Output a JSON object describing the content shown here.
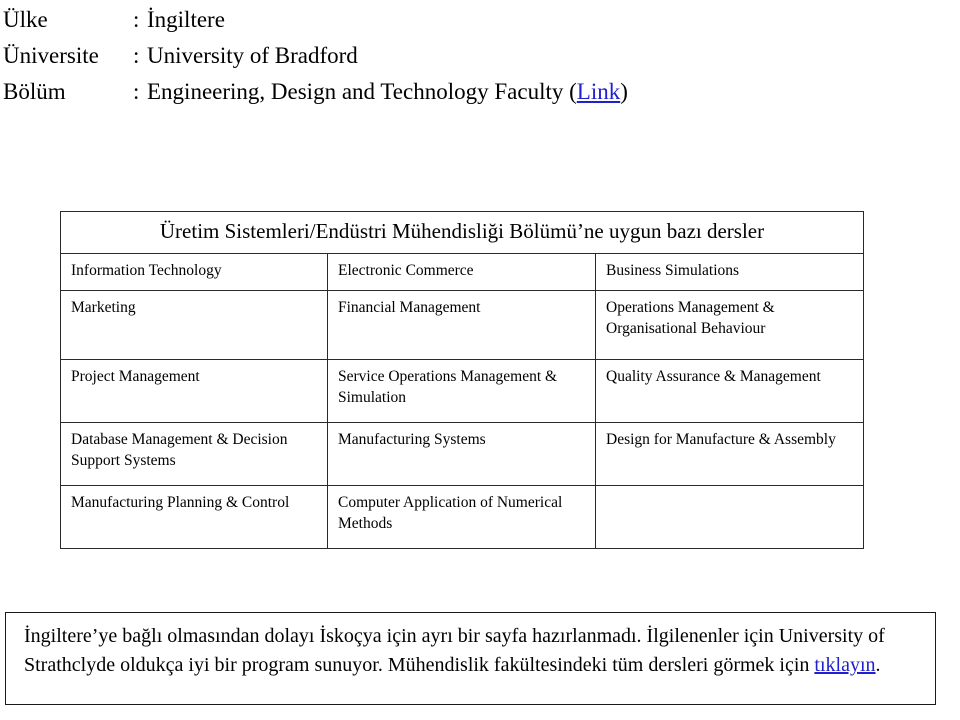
{
  "header": {
    "rows": [
      {
        "label": "Ülke",
        "separator": ":",
        "value": "İngiltere"
      },
      {
        "label": "Üniversite",
        "separator": ":",
        "value": "University of Bradford"
      },
      {
        "label": "Bölüm",
        "separator": ":",
        "value": "Engineering, Design and Technology Faculty ("
      }
    ],
    "department_link_text": "Link",
    "department_link_close": ")"
  },
  "table": {
    "title": "Üretim Sistemleri/Endüstri Mühendisliği Bölümü’ne uygun bazı dersler",
    "rows": [
      [
        "Information Technology",
        "Electronic Commerce",
        "Business Simulations"
      ],
      [
        "Marketing",
        "Financial Management",
        "Operations Management & Organisational Behaviour"
      ],
      [
        "Project Management",
        "Service Operations Management & Simulation",
        "Quality Assurance & Management"
      ],
      [
        "Database Management & Decision Support Systems",
        "Manufacturing Systems",
        "Design for Manufacture & Assembly"
      ],
      [
        "Manufacturing Planning & Control",
        "Computer Application of Numerical Methods",
        ""
      ]
    ]
  },
  "note": {
    "text_before_link": "İngiltere’ye bağlı olmasından dolayı İskoçya için ayrı bir sayfa hazırlanmadı. İlgilenenler için University of Strathclyde oldukça iyi bir program sunuyor. Mühendislik fakültesindeki tüm dersleri görmek için ",
    "link_text": "tıklayın",
    "text_after_link": "."
  },
  "colors": {
    "link": "#2020cc",
    "text": "#000000",
    "border": "#2a2a2a",
    "background": "#ffffff"
  }
}
